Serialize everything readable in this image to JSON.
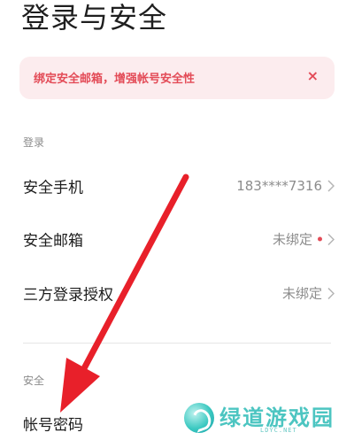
{
  "page": {
    "title": "登录与安全"
  },
  "banner": {
    "text": "绑定安全邮箱，增强帐号安全性",
    "close": "×"
  },
  "sections": {
    "login": {
      "label": "登录"
    },
    "security": {
      "label": "安全"
    }
  },
  "rows": {
    "phone": {
      "label": "安全手机",
      "value": "183****7316"
    },
    "email": {
      "label": "安全邮箱",
      "value": "未绑定"
    },
    "third_party": {
      "label": "三方登录授权",
      "value": "未绑定"
    },
    "password": {
      "label": "帐号密码"
    }
  },
  "watermark": {
    "text": "绿道游戏园",
    "sub": "LDYC.NET"
  },
  "colors": {
    "accent_red": "#e34b57",
    "banner_bg": "#fcecee",
    "watermark": "#4cc5c1"
  }
}
